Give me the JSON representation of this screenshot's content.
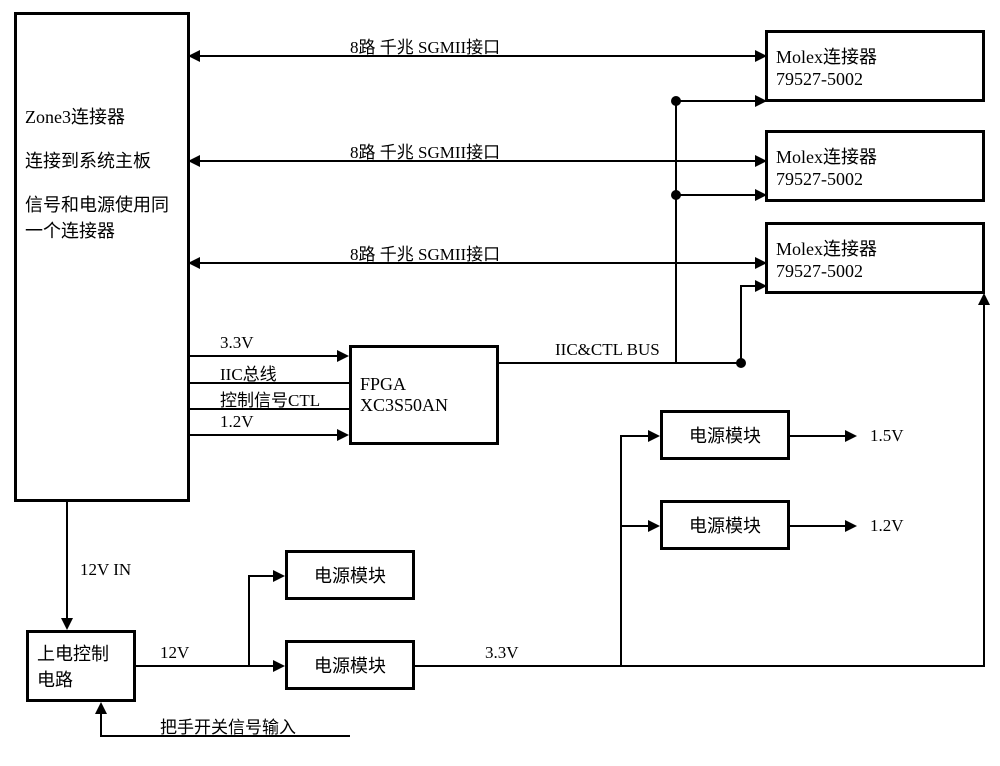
{
  "zone3": {
    "line1": "Zone3连接器",
    "line2": "连接到系统主板",
    "line3": "信号和电源使用同一个连接器"
  },
  "molex": {
    "line1": "Molex连接器",
    "line2": "79527-5002"
  },
  "sgmii_label": "8路 千兆 SGMII接口",
  "fpga": {
    "line1": "FPGA",
    "line2": "XC3S50AN"
  },
  "signals": {
    "v33": "3.3V",
    "iic": "IIC总线",
    "ctl": "控制信号CTL",
    "v12": "1.2V",
    "iic_ctl_bus": "IIC&CTL BUS"
  },
  "power_module": "电源模块",
  "power_ctrl": "上电控制电路",
  "v12_in": "12V IN",
  "v12_label": "12V",
  "v33_out": "3.3V",
  "v15_out": "1.5V",
  "v12_out": "1.2V",
  "handle_switch": "把手开关信号输入"
}
